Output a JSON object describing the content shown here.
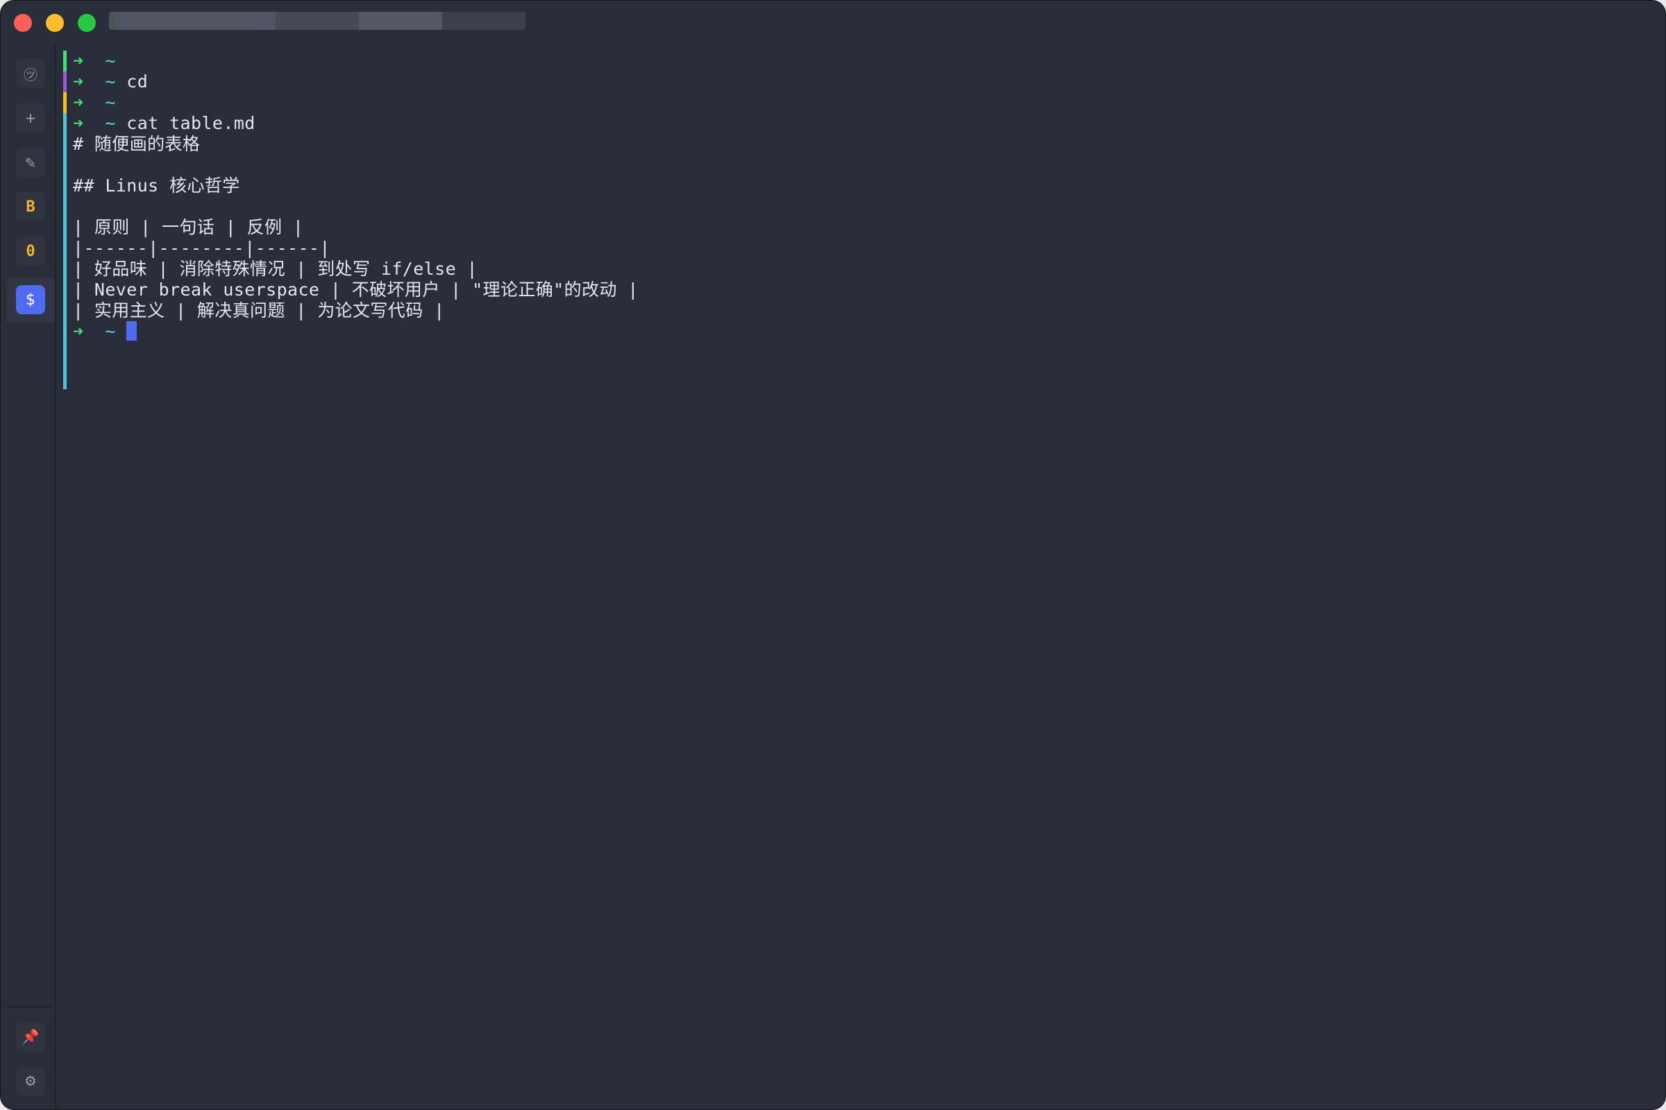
{
  "titlebar": {
    "traffic_lights": {
      "close": "#fe5f57",
      "minimize": "#febc2e",
      "maximize": "#28c840"
    }
  },
  "sidebar": {
    "items": [
      {
        "icon": "history-icon",
        "glyph": "㋡"
      },
      {
        "icon": "plus-icon",
        "glyph": "+"
      },
      {
        "icon": "pencil-icon",
        "glyph": "✎"
      },
      {
        "icon": "letter-b-icon",
        "glyph": "B"
      },
      {
        "icon": "letter-o-icon",
        "glyph": "0"
      },
      {
        "icon": "dollar-terminal-icon",
        "glyph": "$",
        "active": true
      },
      {
        "icon": "pin-icon",
        "glyph": "📌"
      },
      {
        "icon": "gear-icon",
        "glyph": "⚙"
      }
    ]
  },
  "terminal": {
    "prompt": {
      "arrow": "➜",
      "dir": "~"
    },
    "lines": [
      {
        "type": "prompt",
        "cmd": ""
      },
      {
        "type": "prompt",
        "cmd": "cd"
      },
      {
        "type": "prompt",
        "cmd": ""
      },
      {
        "type": "prompt",
        "cmd": "cat table.md"
      },
      {
        "type": "output",
        "text": "# 随便画的表格"
      },
      {
        "type": "output",
        "text": ""
      },
      {
        "type": "output",
        "text": "## Linus 核心哲学"
      },
      {
        "type": "output",
        "text": ""
      },
      {
        "type": "output",
        "text": "| 原则 | 一句话 | 反例 |"
      },
      {
        "type": "output",
        "text": "|------|--------|------|"
      },
      {
        "type": "output",
        "text": "| 好品味 | 消除特殊情况 | 到处写 if/else |"
      },
      {
        "type": "output",
        "text": "| Never break userspace | 不破坏用户 | \"理论正确\"的改动 |"
      },
      {
        "type": "output",
        "text": "| 实用主义 | 解决真问题 | 为论文写代码 |"
      },
      {
        "type": "prompt",
        "cmd": "",
        "cursor": true
      }
    ],
    "gutter_colors": [
      "#3ee07a",
      "#9b59d6",
      "#f0c419",
      "#4fc3d9"
    ]
  }
}
